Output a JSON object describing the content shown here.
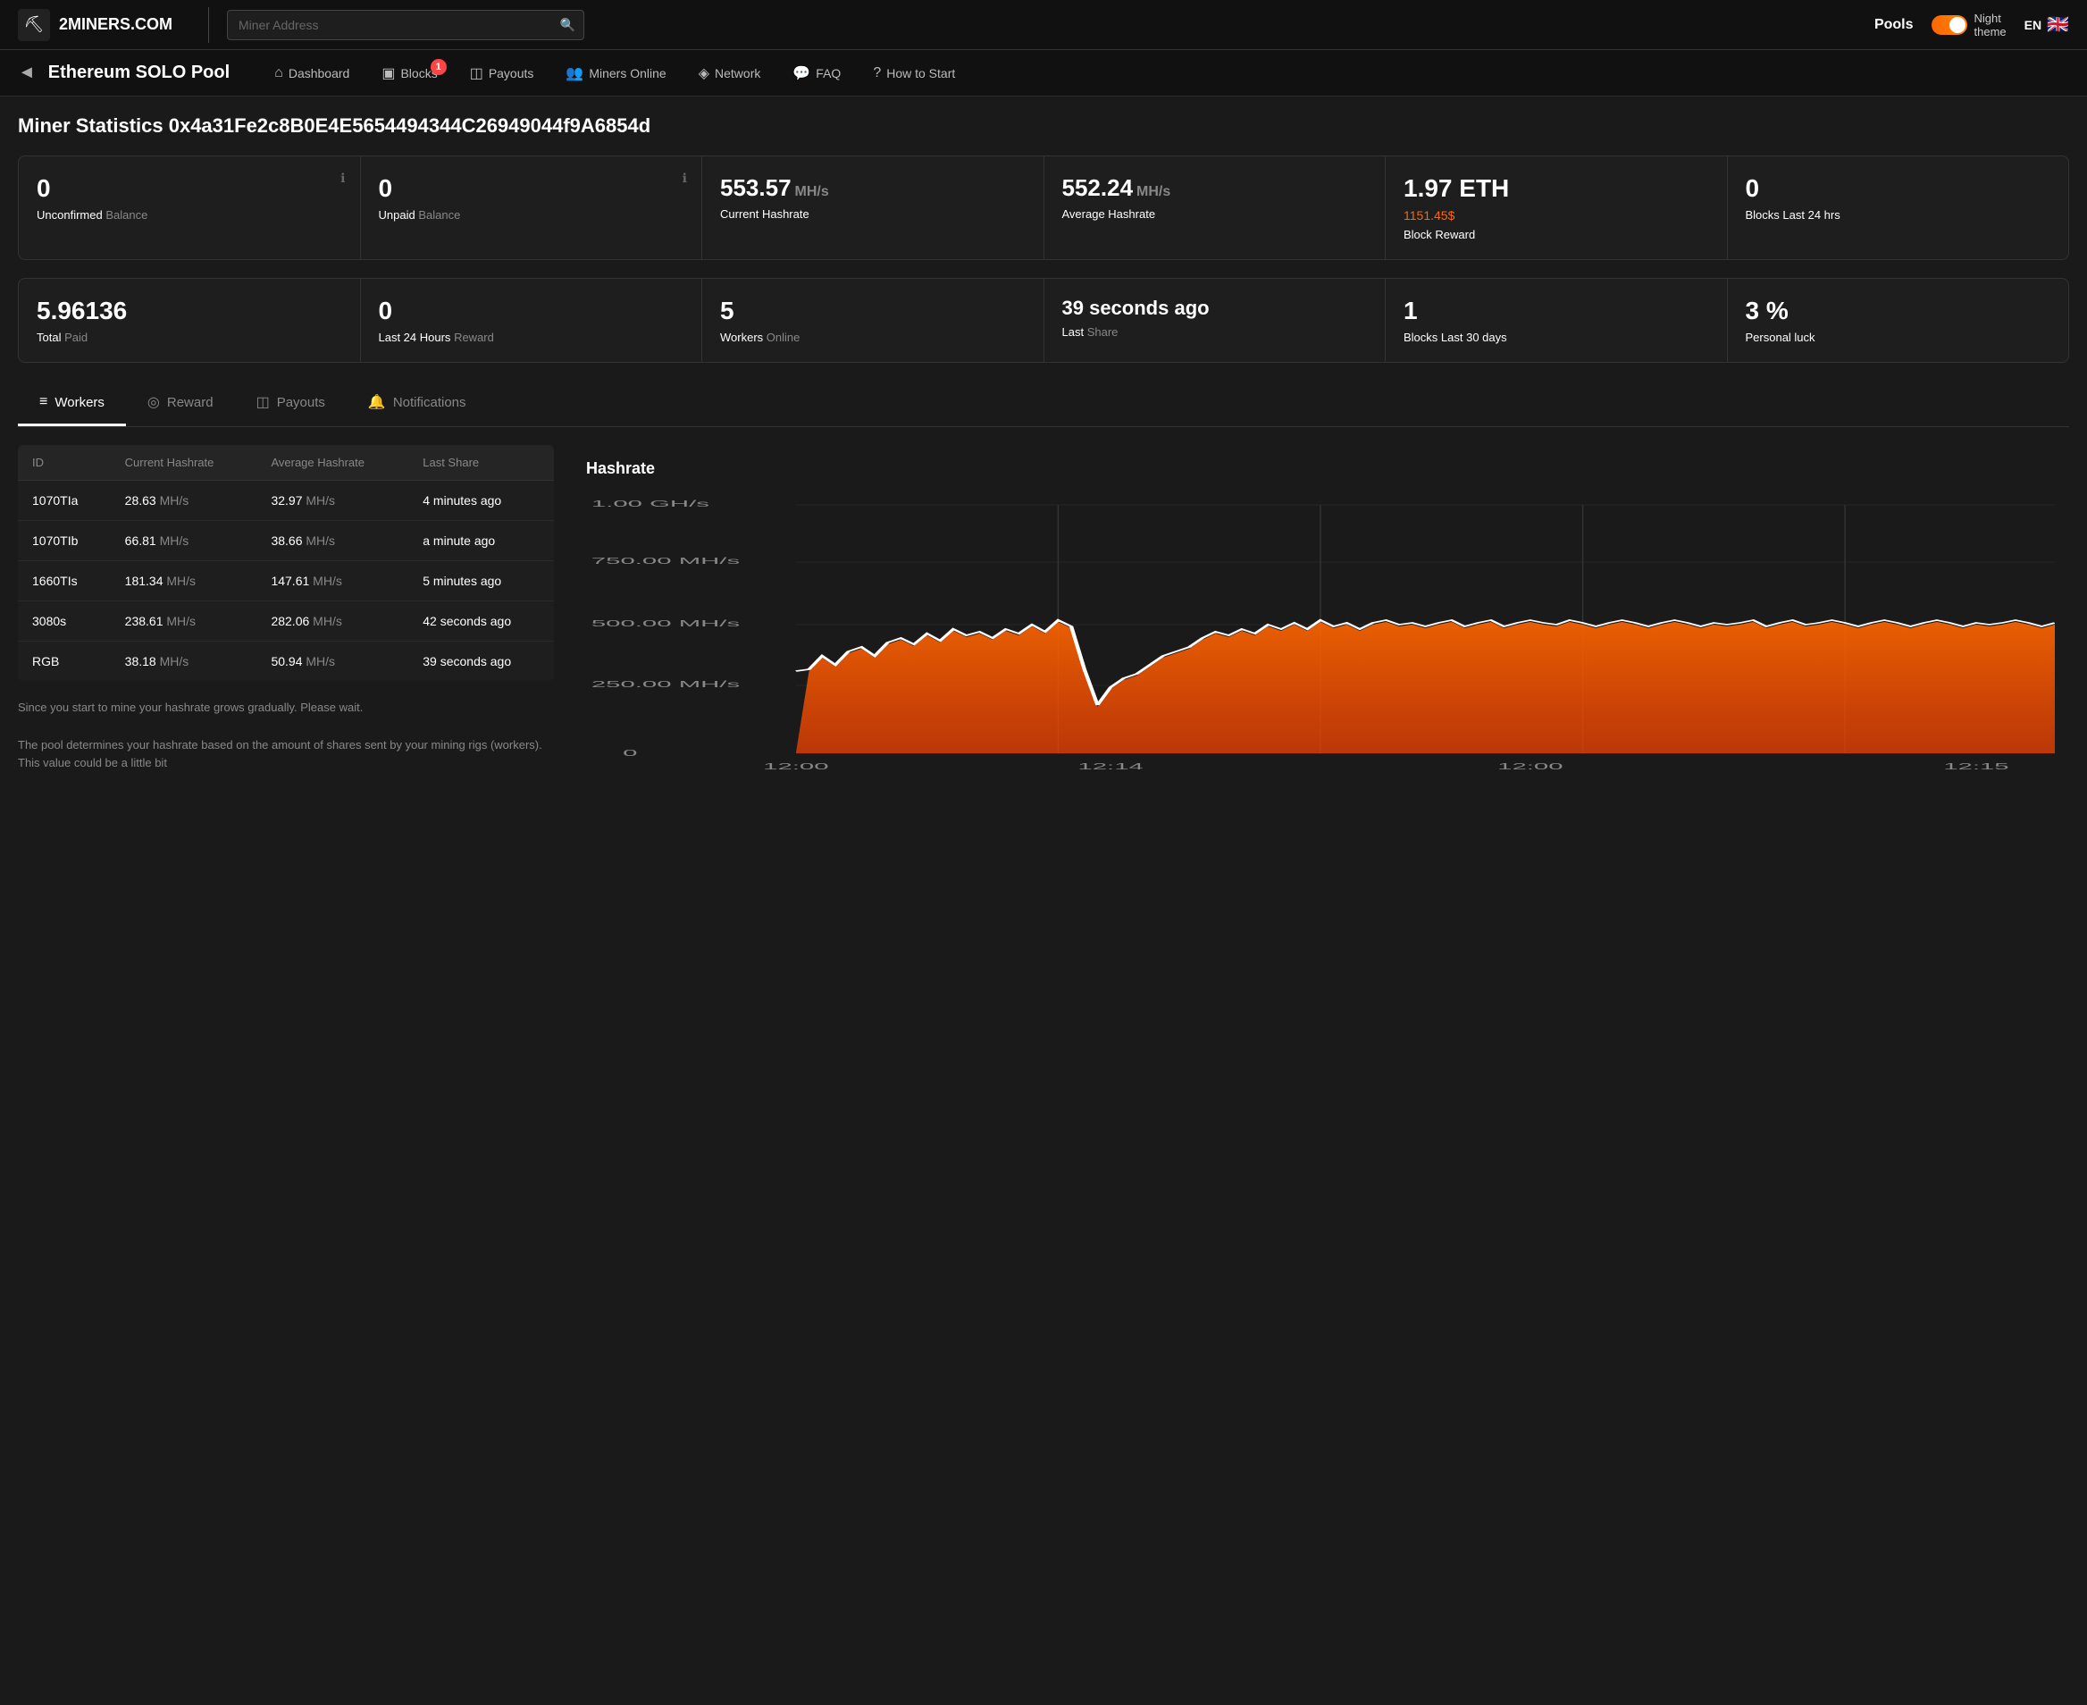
{
  "topnav": {
    "logo_icon": "⛏",
    "logo_text": "2MINERS.COM",
    "search_placeholder": "Miner Address",
    "pools_label": "Pools",
    "night_theme_label": "Night\ntheme",
    "lang": "EN"
  },
  "poolnav": {
    "back_icon": "◄",
    "pool_title": "Ethereum SOLO Pool",
    "items": [
      {
        "icon": "⌂",
        "label": "Dashboard",
        "badge": null
      },
      {
        "icon": "▣",
        "label": "Blocks",
        "badge": "1"
      },
      {
        "icon": "◫",
        "label": "Payouts",
        "badge": null
      },
      {
        "icon": "👥",
        "label": "Miners Online",
        "badge": null
      },
      {
        "icon": "◈",
        "label": "Network",
        "badge": null
      },
      {
        "icon": "💬",
        "label": "FAQ",
        "badge": null
      },
      {
        "icon": "?",
        "label": "How to Start",
        "badge": null
      }
    ]
  },
  "miner": {
    "title_prefix": "Miner Statistics ",
    "address": "0x4a31Fe2c8B0E4E5654494344C26949044f9A6854d"
  },
  "stats": [
    {
      "value": "0",
      "label_white": "Unconfirmed",
      "label_grey": "Balance",
      "has_info": true,
      "unit": ""
    },
    {
      "value": "0",
      "label_white": "Unpaid",
      "label_grey": "Balance",
      "has_info": true,
      "unit": ""
    },
    {
      "value": "553.57",
      "unit": "MH/s",
      "label_white": "Current Hashrate",
      "label_grey": "",
      "has_info": false
    },
    {
      "value": "552.24",
      "unit": "MH/s",
      "label_white": "Average Hashrate",
      "label_grey": "",
      "has_info": false
    },
    {
      "value": "1.97 ETH",
      "unit": "",
      "sub": "1151.45$",
      "label_white": "Block Reward",
      "label_grey": "",
      "has_info": false
    },
    {
      "value": "0",
      "unit": "",
      "label_white": "Blocks Last 24 hrs",
      "label_grey": "",
      "has_info": false
    }
  ],
  "stats2": [
    {
      "value": "5.96136",
      "unit": "",
      "label_white": "Total",
      "label_grey": "Paid",
      "has_info": false
    },
    {
      "value": "0",
      "unit": "",
      "label_white": "Last 24 Hours",
      "label_grey": "Reward",
      "has_info": false
    },
    {
      "value": "5",
      "unit": "",
      "label_white": "Workers",
      "label_grey": "Online",
      "has_info": false
    },
    {
      "value": "39 seconds ago",
      "unit": "",
      "label_white": "Last",
      "label_grey": "Share",
      "has_info": false
    },
    {
      "value": "1",
      "unit": "",
      "label_white": "Blocks Last 30 days",
      "label_grey": "",
      "has_info": false
    },
    {
      "value": "3 %",
      "unit": "",
      "label_white": "Personal luck",
      "label_grey": "",
      "has_info": false
    }
  ],
  "tabs": [
    {
      "icon": "≡",
      "label": "Workers",
      "active": true
    },
    {
      "icon": "◎",
      "label": "Reward",
      "active": false
    },
    {
      "icon": "◫",
      "label": "Payouts",
      "active": false
    },
    {
      "icon": "🔔",
      "label": "Notifications",
      "active": false
    }
  ],
  "table": {
    "columns": [
      "ID",
      "Current Hashrate",
      "Average Hashrate",
      "Last Share"
    ],
    "rows": [
      {
        "id": "1070TIa",
        "current": "28.63",
        "current_unit": "MH/s",
        "average": "32.97",
        "average_unit": "MH/s",
        "last_share": "4 minutes ago"
      },
      {
        "id": "1070TIb",
        "current": "66.81",
        "current_unit": "MH/s",
        "average": "38.66",
        "average_unit": "MH/s",
        "last_share": "a minute ago"
      },
      {
        "id": "1660TIs",
        "current": "181.34",
        "current_unit": "MH/s",
        "average": "147.61",
        "average_unit": "MH/s",
        "last_share": "5 minutes ago"
      },
      {
        "id": "3080s",
        "current": "238.61",
        "current_unit": "MH/s",
        "average": "282.06",
        "average_unit": "MH/s",
        "last_share": "42 seconds ago"
      },
      {
        "id": "RGB",
        "current": "38.18",
        "current_unit": "MH/s",
        "average": "50.94",
        "average_unit": "MH/s",
        "last_share": "39 seconds ago"
      }
    ]
  },
  "notes": [
    "Since you start to mine your hashrate grows gradually. Please wait.",
    "The pool determines your hashrate based on the amount of shares sent by your mining rigs (workers). This value could be a little bit"
  ],
  "chart": {
    "title": "Hashrate",
    "y_labels": [
      "1.00 GH/s",
      "750.00 MH/s",
      "500.00 MH/s",
      "250.00 MH/s",
      "0"
    ],
    "x_labels": [
      "12:00",
      "12:14",
      "12:00",
      "12:15"
    ]
  }
}
